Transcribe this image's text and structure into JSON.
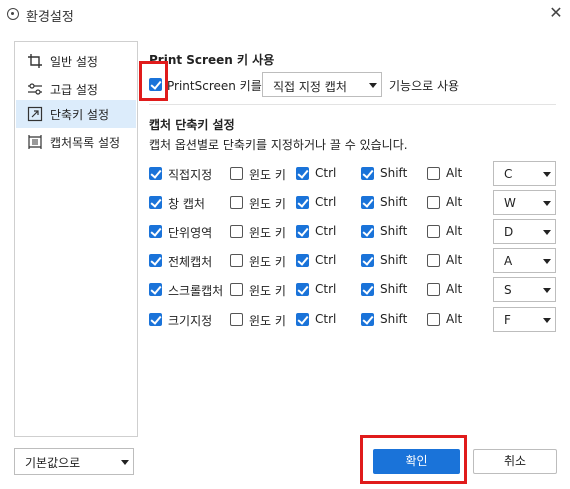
{
  "window": {
    "title": "환경설정"
  },
  "sidebar": {
    "items": [
      {
        "label": "일반 설정",
        "icon": "crop-icon",
        "active": false
      },
      {
        "label": "고급 설정",
        "icon": "sliders-icon",
        "active": false
      },
      {
        "label": "단축키 설정",
        "icon": "shortcut-icon",
        "active": true
      },
      {
        "label": "캡처목록 설정",
        "icon": "capture-list-icon",
        "active": false
      }
    ]
  },
  "defaults_select": {
    "value": "기본값으로"
  },
  "print_screen": {
    "title": "Print Screen 키 사용",
    "checkbox_checked": true,
    "label_before": "PrintScreen 키를",
    "select_value": "직접 지정 캡처",
    "label_after": "기능으로 사용"
  },
  "shortcuts": {
    "title": "캡처 단축키 설정",
    "description": "캡처 옵션별로 단축키를 지정하거나 끌 수 있습니다.",
    "modifier_labels": {
      "win": "윈도 키",
      "ctrl": "Ctrl",
      "shift": "Shift",
      "alt": "Alt"
    },
    "rows": [
      {
        "label": "직접지정",
        "enabled": true,
        "win": false,
        "ctrl": true,
        "shift": true,
        "alt": false,
        "key": "C"
      },
      {
        "label": "창 캡처",
        "enabled": true,
        "win": false,
        "ctrl": true,
        "shift": true,
        "alt": false,
        "key": "W"
      },
      {
        "label": "단위영역",
        "enabled": true,
        "win": false,
        "ctrl": true,
        "shift": true,
        "alt": false,
        "key": "D"
      },
      {
        "label": "전체캡처",
        "enabled": true,
        "win": false,
        "ctrl": true,
        "shift": true,
        "alt": false,
        "key": "A"
      },
      {
        "label": "스크롤캡처",
        "enabled": true,
        "win": false,
        "ctrl": true,
        "shift": true,
        "alt": false,
        "key": "S"
      },
      {
        "label": "크기지정",
        "enabled": true,
        "win": false,
        "ctrl": true,
        "shift": true,
        "alt": false,
        "key": "F"
      }
    ]
  },
  "buttons": {
    "ok": "확인",
    "cancel": "취소"
  },
  "colors": {
    "accent": "#1a73d9",
    "highlight": "#e01b1b",
    "active_item": "#dcecfb"
  }
}
